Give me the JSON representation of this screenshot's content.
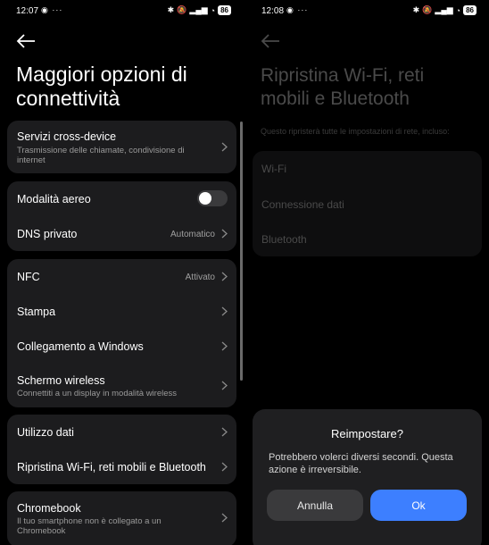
{
  "left": {
    "status": {
      "time": "12:07",
      "icons_left": "◉ ···",
      "battery": "86"
    },
    "title": "Maggiori opzioni di connettività",
    "groups": [
      {
        "items": [
          {
            "label": "Servizi cross-device",
            "sub": "Trasmissione delle chiamate, condivisione di internet"
          }
        ]
      },
      {
        "items": [
          {
            "label": "Modalità aereo",
            "toggle": "off"
          },
          {
            "label": "DNS privato",
            "value": "Automatico"
          }
        ]
      },
      {
        "items": [
          {
            "label": "NFC",
            "value": "Attivato"
          },
          {
            "label": "Stampa"
          },
          {
            "label": "Collegamento a Windows"
          },
          {
            "label": "Schermo wireless",
            "sub": "Connettiti a un display in modalità wireless"
          }
        ]
      },
      {
        "items": [
          {
            "label": "Utilizzo dati"
          },
          {
            "label": "Ripristina Wi-Fi, reti mobili e Bluetooth"
          }
        ]
      },
      {
        "items": [
          {
            "label": "Chromebook",
            "sub": "Il tuo smartphone non è collegato a un Chromebook"
          }
        ]
      }
    ]
  },
  "right": {
    "status": {
      "time": "12:08",
      "icons_left": "◉ ···",
      "battery": "86"
    },
    "title": "Ripristina Wi-Fi, reti mobili e Bluetooth",
    "description": "Questo ripristerà tutte le impostazioni di rete, incluso:",
    "items": [
      "Wi-Fi",
      "Connessione dati",
      "Bluetooth"
    ],
    "dialog": {
      "title": "Reimpostare?",
      "message": "Potrebbero volerci diversi secondi. Questa azione è irreversibile.",
      "cancel_label": "Annulla",
      "ok_label": "Ok"
    }
  },
  "colors": {
    "card_bg": "#1c1c1e",
    "accent": "#3d7fff",
    "secondary_text": "#9a9a9a"
  }
}
